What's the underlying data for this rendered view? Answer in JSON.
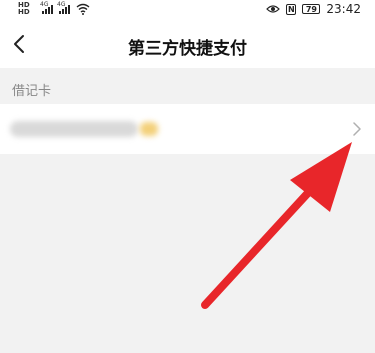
{
  "status_bar": {
    "time": "23:42",
    "battery": "79",
    "nfc_label": "N",
    "hd_badge": "HD HD",
    "signal_1_label": "4G",
    "signal_2_label": "4G"
  },
  "nav": {
    "title": "第三方快捷支付"
  },
  "section": {
    "label": "借记卡"
  },
  "colors": {
    "arrow": "#e8262a",
    "background": "#f2f2f2"
  },
  "icons": [
    "back-arrow-icon",
    "chevron-right-icon",
    "wifi-icon",
    "eye-icon",
    "signal-icon",
    "battery-icon"
  ]
}
